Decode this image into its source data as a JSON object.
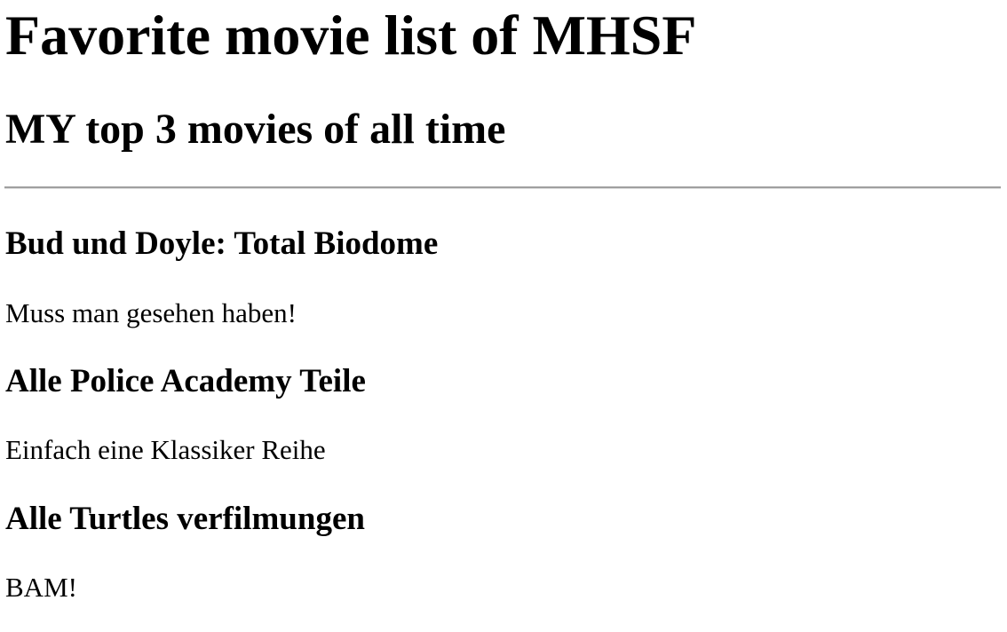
{
  "title": "Favorite movie list of MHSF",
  "subtitle": "MY top 3 movies of all time",
  "movies": [
    {
      "title": "Bud und Doyle: Total Biodome",
      "comment": "Muss man gesehen haben!"
    },
    {
      "title": "Alle Police Academy Teile",
      "comment": "Einfach eine Klassiker Reihe"
    },
    {
      "title": "Alle Turtles verfilmungen",
      "comment": "BAM!"
    }
  ]
}
